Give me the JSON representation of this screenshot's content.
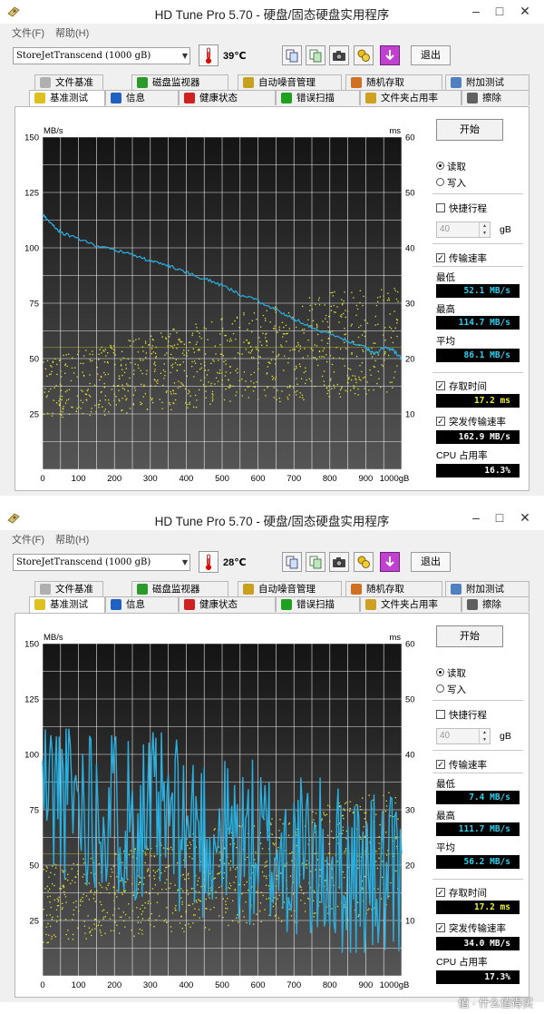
{
  "windows": [
    {
      "title": "HD Tune Pro 5.70 - 硬盘/固态硬盘实用程序",
      "menu": [
        "文件(F)",
        "帮助(H)"
      ],
      "drive": "StoreJetTranscend (1000 gB)",
      "temperature": "39℃",
      "exit_label": "退出",
      "tabs_top": [
        "文件基准",
        "磁盘监视器",
        "自动噪音管理",
        "随机存取",
        "附加测试"
      ],
      "tabs_bottom": [
        "基准测试",
        "信息",
        "健康状态",
        "错误扫描",
        "文件夹占用率",
        "擦除"
      ],
      "start_label": "开始",
      "radio_read": "读取",
      "radio_write": "写入",
      "quick_label": "快捷行程",
      "quick_value": "40",
      "quick_unit": "gB",
      "transfer_label": "传输速率",
      "min_label": "最低",
      "min_value": "52.1 MB/s",
      "max_label": "最高",
      "max_value": "114.7 MB/s",
      "avg_label": "平均",
      "avg_value": "86.1 MB/s",
      "access_label": "存取时间",
      "access_value": "17.2 ms",
      "burst_label": "突发传输速率",
      "burst_value": "162.9 MB/s",
      "cpu_label": "CPU 占用率",
      "cpu_value": "16.3%",
      "chart": {
        "left_unit": "MB/s",
        "right_unit": "ms",
        "y_left_ticks": [
          "150",
          "125",
          "100",
          "75",
          "50",
          "25"
        ],
        "y_right_ticks": [
          "60",
          "50",
          "40",
          "30",
          "20",
          "10"
        ],
        "x_ticks": [
          "0",
          "100",
          "200",
          "300",
          "400",
          "500",
          "600",
          "700",
          "800",
          "900",
          "1000gB"
        ]
      }
    },
    {
      "title": "HD Tune Pro 5.70 - 硬盘/固态硬盘实用程序",
      "menu": [
        "文件(F)",
        "帮助(H)"
      ],
      "drive": "StoreJetTranscend (1000 gB)",
      "temperature": "28℃",
      "exit_label": "退出",
      "tabs_top": [
        "文件基准",
        "磁盘监视器",
        "自动噪音管理",
        "随机存取",
        "附加测试"
      ],
      "tabs_bottom": [
        "基准测试",
        "信息",
        "健康状态",
        "错误扫描",
        "文件夹占用率",
        "擦除"
      ],
      "start_label": "开始",
      "radio_read": "读取",
      "radio_write": "写入",
      "quick_label": "快捷行程",
      "quick_value": "40",
      "quick_unit": "gB",
      "transfer_label": "传输速率",
      "min_label": "最低",
      "min_value": "7.4 MB/s",
      "max_label": "最高",
      "max_value": "111.7 MB/s",
      "avg_label": "平均",
      "avg_value": "56.2 MB/s",
      "access_label": "存取时间",
      "access_value": "17.2 ms",
      "burst_label": "突发传输速率",
      "burst_value": "34.0 MB/s",
      "cpu_label": "CPU 占用率",
      "cpu_value": "17.3%",
      "chart": {
        "left_unit": "MB/s",
        "right_unit": "ms",
        "y_left_ticks": [
          "150",
          "125",
          "100",
          "75",
          "50",
          "25"
        ],
        "y_right_ticks": [
          "60",
          "50",
          "40",
          "30",
          "20",
          "10"
        ],
        "x_ticks": [
          "0",
          "100",
          "200",
          "300",
          "400",
          "500",
          "600",
          "700",
          "800",
          "900",
          "1000gB"
        ]
      }
    }
  ],
  "watermark": "值 · 什么值得买",
  "chart_data": [
    {
      "type": "line",
      "title": "",
      "xlabel": "",
      "ylabel": "MB/s",
      "y2label": "ms",
      "xlim": [
        0,
        1000
      ],
      "ylim": [
        0,
        150
      ],
      "y2lim": [
        0,
        60
      ],
      "grid": true,
      "series": [
        {
          "axis": "left",
          "style": "line",
          "x": [
            0,
            25,
            50,
            100,
            150,
            200,
            250,
            300,
            350,
            400,
            450,
            500,
            550,
            600,
            650,
            700,
            750,
            800,
            850,
            900,
            925,
            950,
            975,
            1000
          ],
          "y": [
            115,
            111,
            107,
            104,
            101,
            99,
            97,
            94,
            92,
            89,
            86,
            83,
            79,
            76,
            72,
            68,
            64,
            61,
            58,
            55,
            52,
            55,
            54,
            50
          ]
        },
        {
          "axis": "right",
          "style": "scatter",
          "density": 1,
          "range": [
            9,
            33
          ],
          "trend": "rising"
        },
        {
          "axis": "left",
          "style": "line",
          "y": [
            55,
            55
          ]
        }
      ]
    },
    {
      "type": "line",
      "title": "",
      "xlabel": "",
      "ylabel": "MB/s",
      "y2label": "ms",
      "xlim": [
        0,
        1000
      ],
      "ylim": [
        0,
        150
      ],
      "y2lim": [
        0,
        60
      ],
      "grid": true,
      "series": [
        {
          "axis": "left",
          "style": "noisy-line",
          "min": 7.4,
          "max": 111.7,
          "avg": 56.2,
          "trend": [
            85,
            40
          ]
        },
        {
          "axis": "right",
          "style": "scatter",
          "density": 1,
          "range": [
            6,
            32
          ],
          "trend": "rising"
        },
        {
          "axis": "left",
          "style": "line",
          "y": [
            55,
            55
          ]
        }
      ]
    }
  ],
  "colors": {
    "read_line": "#2ab0e0",
    "access_dots": "#e8e832",
    "grid": "#ffffff",
    "plot_bg_top": "#141414",
    "plot_bg_bottom": "#555555"
  }
}
